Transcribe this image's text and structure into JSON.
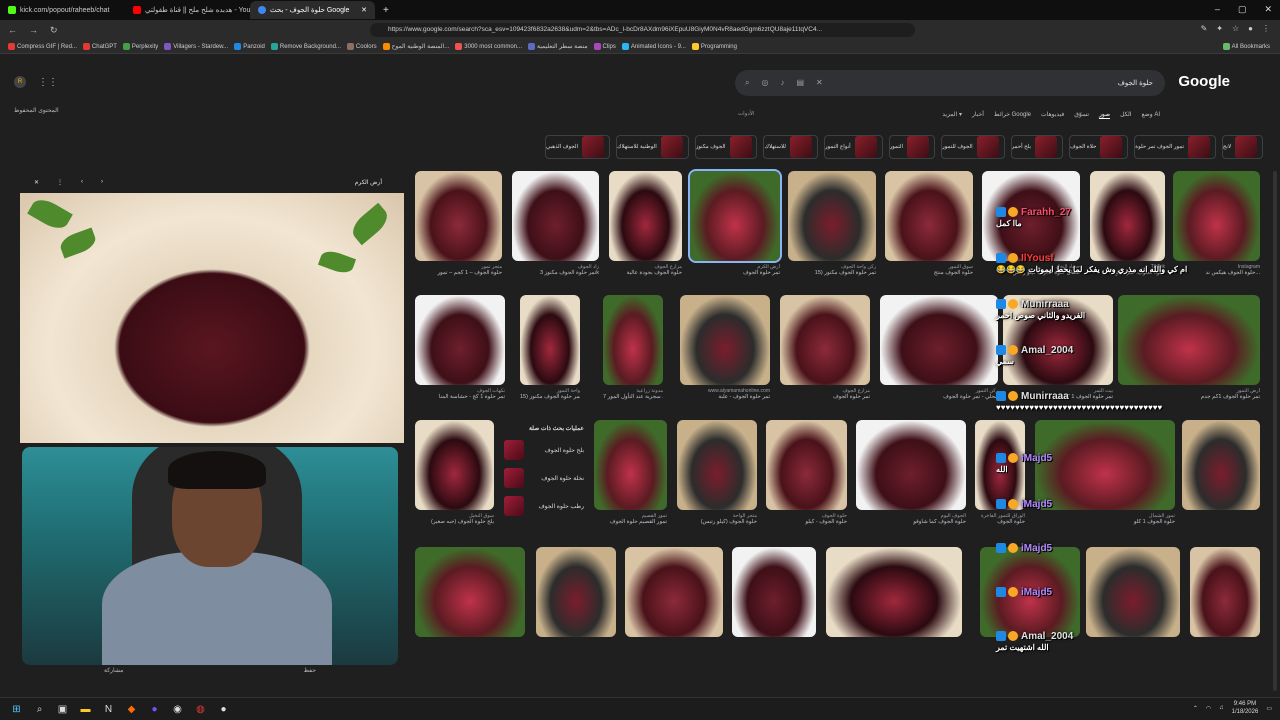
{
  "tabs": [
    {
      "label": "kick.com/popout/raheeb/chat",
      "color": "#53fc18"
    },
    {
      "label": "هدبده شلح ملح || قناة طفولتي - YouTube",
      "color": "#ff0000"
    },
    {
      "label": "حلوة الجوف - بحث Google",
      "color": "#4285f4",
      "active": true
    }
  ],
  "window_controls": [
    "–",
    "▢",
    "✕"
  ],
  "nav": {
    "back": "←",
    "forward": "→",
    "reload": "↻"
  },
  "url": "https://www.google.com/search?sca_esv=109423f6832a2638&udm=2&tbs=ADc_I-bcDr8AXdm96iXEpuU8GiyM0N4vR8aedGgm6zztQU8aje11tqVC4...",
  "bookmarks": [
    "Compress GIF | Red...",
    "ChatGPT",
    "Perplexity",
    "Villagers - Stardew...",
    "Panzoid",
    "Remove Background...",
    "Coolors",
    "المنصة الوطنية الموح...",
    "3000 most common...",
    "منصة سطر التعليمية",
    "Clips",
    "Animated Icons - 9...",
    "Programming",
    "All Bookmarks"
  ],
  "bookmark_colors": [
    "#e53935",
    "#e53935",
    "#43a047",
    "#7e57c2",
    "#1e88e5",
    "#26a69a",
    "#8d6e63",
    "#fb8c00",
    "#ef5350",
    "#5c6bc0",
    "#ab47bc",
    "#29b6f6",
    "#ffca28",
    "#66bb6a"
  ],
  "google": {
    "logo": "Google",
    "query": "حلوة الجوف",
    "saved": "المحتوى المحفوظ",
    "tools": "الأدوات",
    "avatar": "R"
  },
  "filters": [
    {
      "label": "وضع AI"
    },
    {
      "label": "الكل"
    },
    {
      "label": "صور",
      "selected": true
    },
    {
      "label": "تسوّق"
    },
    {
      "label": "فيديوهات"
    },
    {
      "label": "خرائط Google"
    },
    {
      "label": "أخبار"
    },
    {
      "label": "المزيد ▾"
    }
  ],
  "chips": [
    "لانج",
    "تمور الجوف تمر حلوة",
    "حلاة الجوف",
    "بلح أحمر",
    "الجوف للتمور",
    "التمور",
    "أنواع التمور",
    "للاستهلاك",
    "الجوف مكنوز",
    "الوطنية للاستهلاك",
    "الجوف الذهبي"
  ],
  "preview": {
    "source": "أرض الكرم",
    "close": "✕",
    "more": "⋮",
    "prev": "‹",
    "next": "›",
    "share": "مشاركة",
    "save": "حفظ"
  },
  "related": {
    "title": "عمليات بحث ذات صلة",
    "items": [
      "بلح حلوة الجوف",
      "نخلة حلوة الجوف",
      "رطب حلوة الجوف"
    ]
  },
  "results": [
    {
      "cap": "حلوة الجوف – 1 كجم – تمور",
      "src": "متجر تمور"
    },
    {
      "cap": "تمر حلوة الجوف مكنوز 3k",
      "src": "زاد الجوف"
    },
    {
      "cap": "حلوة الجوف بجودة عالية",
      "src": "مزارع الجوف"
    },
    {
      "cap": "تمر حلوة الجوف",
      "src": "أرض الكرم"
    },
    {
      "cap": "تمر حلوة الجوف مكنوز (15",
      "src": "ركن واحة الجوف"
    },
    {
      "cap": "حلوة الجوف منتج",
      "src": "سوق التمور"
    },
    {
      "cap": "سطل حلوة الجوف كيلو رتبس",
      "src": "حصاد النخل"
    },
    {
      "cap": "حلوة الجوف: تمر شائع",
      "src": "TikTok"
    },
    {
      "cap": "حلوة الجوف هيكس ند...",
      "src": "Instagram"
    },
    {
      "cap": "تمر حلوة 1 كج - خشاسة المنا",
      "src": "نكهات الجوف"
    },
    {
      "cap": "تمر حلوة الجوف مكنوز (15",
      "src": "واحة التمور"
    },
    {
      "cap": "7 تولك سجرية عند التأول المور",
      "src": "مدونة زراعية"
    },
    {
      "cap": "تمر حلوة الجوف - علبة",
      "src": "www.alyamamahonline.com"
    },
    {
      "cap": "تمر حلوة الجوف",
      "src": "مزارع الجوف"
    },
    {
      "cap": "محلي - تمر حلوة الجوف",
      "src": "ركن التمور"
    },
    {
      "cap": "تمر حلوة الجوف 1 كيلو",
      "src": "بيت التمر"
    },
    {
      "cap": "تمر حلوة الجوف 1كم جدم",
      "src": "أرض التمور"
    },
    {
      "cap": "بلح حلوة الجوف (حبه صغير)",
      "src": "سوق النخيل"
    },
    {
      "cap": "تمور القصيم حلوة الجوف",
      "src": "تمور القصيم"
    },
    {
      "cap": "حلوة الجوف (كيلو رتبس)",
      "src": "متجر الواحة"
    },
    {
      "cap": "حلوة الجوف - كيلو",
      "src": "حلوة الجوف"
    },
    {
      "cap": "حلوة الجوف كما شاوقو",
      "src": "الجوف اليوم"
    },
    {
      "cap": "حلوة الجوف",
      "src": "الوراق للتمور الفاخرة"
    },
    {
      "cap": "حلوة الجوف 1 كلو",
      "src": "تمور الشمال"
    }
  ],
  "chat": [
    {
      "user": "Farahh_27",
      "color": "#ff4d6d",
      "msg": "ماا كمل"
    },
    {
      "user": "IlYousf",
      "color": "#ff3b3b",
      "msg": "😂😂😂 ام كي والله انه مذري وش يفكر لما يحط ايموتات"
    },
    {
      "user": "Munirraaa",
      "color": "#e0e0e0",
      "msg": "الفريدو والثاني صوص احمر"
    },
    {
      "user": "Amal_2004",
      "color": "#e0e0e0",
      "msg": "سمي"
    },
    {
      "user": "Munirraaa",
      "color": "#e0e0e0",
      "msg": "♥♥♥♥♥♥♥♥♥♥♥♥♥♥♥♥♥♥♥♥♥♥♥♥♥♥♥♥♥♥♥♥♥♥♥"
    },
    {
      "user": "iMajd5",
      "color": "#b388ff",
      "msg": "الله"
    },
    {
      "user": "iMajd5",
      "color": "#b388ff",
      "msg": ""
    },
    {
      "user": "iMajd5",
      "color": "#b388ff",
      "msg": ""
    },
    {
      "user": "iMajd5",
      "color": "#b388ff",
      "msg": ""
    },
    {
      "user": "Amal_2004",
      "color": "#e0e0e0",
      "msg": "الله اشتهيت تمر"
    }
  ],
  "taskbar": {
    "time": "9:46 PM",
    "date": "1/18/2026"
  }
}
